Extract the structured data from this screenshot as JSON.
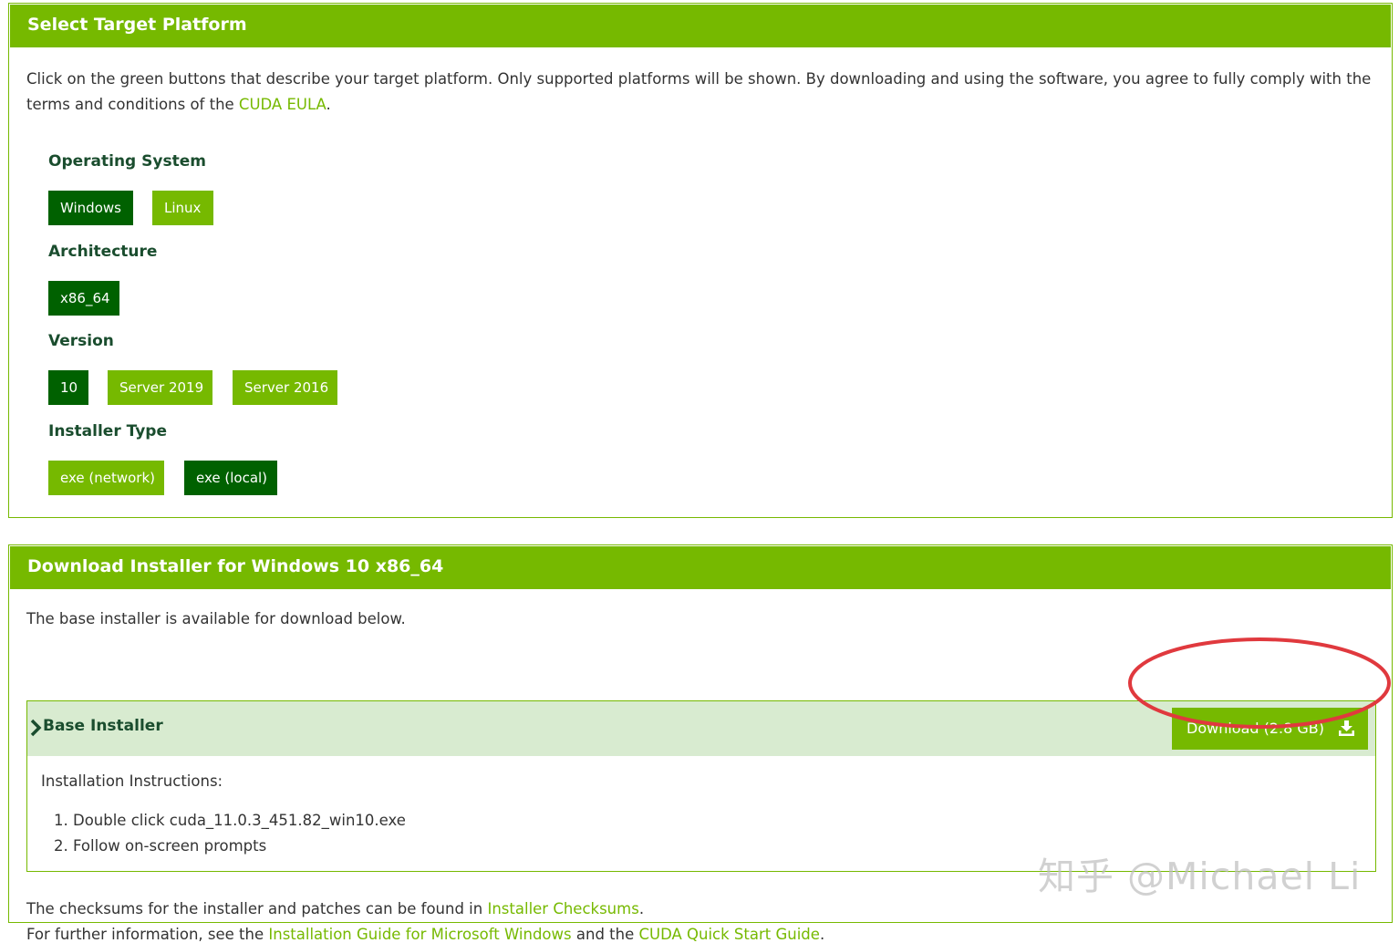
{
  "platform": {
    "title": "Select Target Platform",
    "intro_text": "Click on the green buttons that describe your target platform. Only supported platforms will be shown. By downloading and using the software, you agree to fully comply with the terms and conditions of the ",
    "eula_link": "CUDA EULA",
    "intro_end": ".",
    "os": {
      "label": "Operating System",
      "options": [
        "Windows",
        "Linux"
      ],
      "selected": "Windows"
    },
    "arch": {
      "label": "Architecture",
      "options": [
        "x86_64"
      ],
      "selected": "x86_64"
    },
    "version": {
      "label": "Version",
      "options": [
        "10",
        "Server 2019",
        "Server 2016"
      ],
      "selected": "10"
    },
    "installer_type": {
      "label": "Installer Type",
      "options": [
        "exe (network)",
        "exe (local)"
      ],
      "selected": "exe (local)"
    }
  },
  "download": {
    "title": "Download Installer for Windows 10 x86_64",
    "subtitle": "The base installer is available for download below.",
    "base_installer": {
      "label": "Base Installer",
      "button": "Download (2.8 GB)",
      "instructions_label": "Installation Instructions:",
      "steps": [
        "1. Double click cuda_11.0.3_451.82_win10.exe",
        "2. Follow on-screen prompts"
      ]
    },
    "checksums_prefix": "The checksums for the installer and patches can be found in ",
    "checksums_link": "Installer Checksums",
    "checksums_suffix": ".",
    "info_prefix": "For further information, see the ",
    "guide_link": "Installation Guide for Microsoft Windows",
    "info_mid": " and the ",
    "quickstart_link": "CUDA Quick Start Guide",
    "info_suffix": "."
  },
  "watermark": "知乎 @Michael Li",
  "colors": {
    "brand_green": "#76b900",
    "active_green": "#006100",
    "highlight_bg": "#d8ebd0",
    "annotation_red": "#e0393e"
  }
}
